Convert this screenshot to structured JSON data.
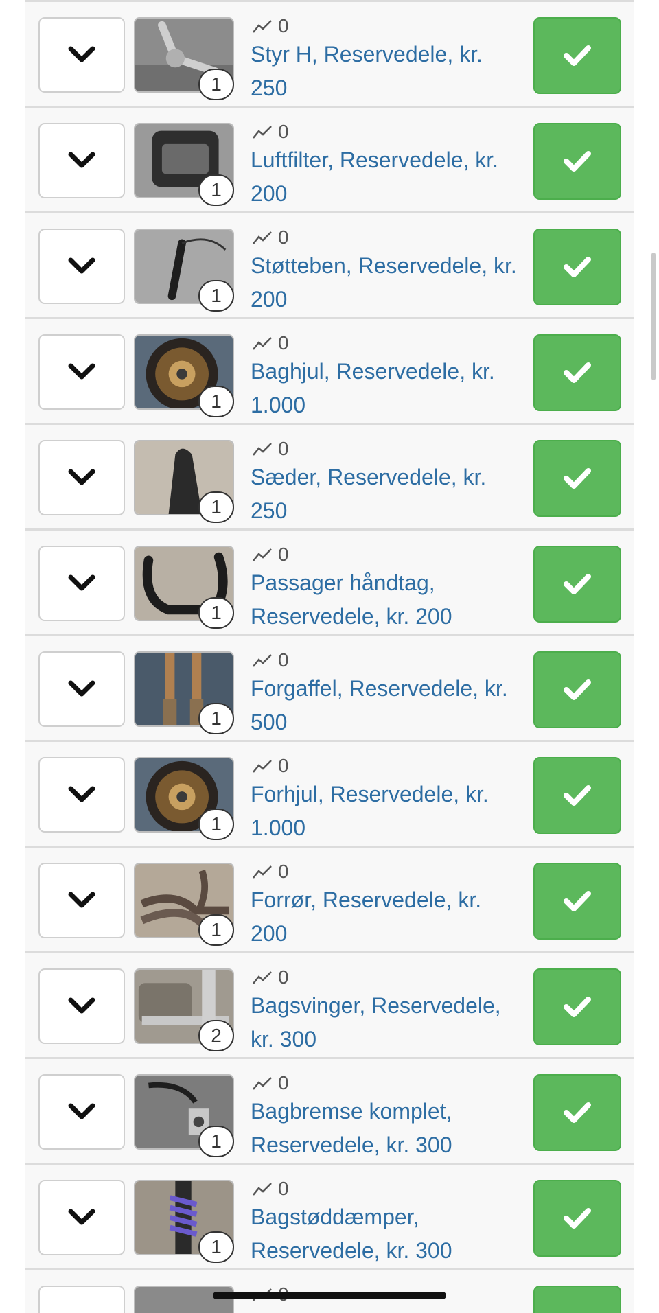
{
  "items": [
    {
      "title": "Styr H, Reservedele, kr. 250",
      "views": "0",
      "photo_count": "1",
      "thumb_icon": "handlebar-photo"
    },
    {
      "title": "Luftfilter, Reservedele, kr. 200",
      "views": "0",
      "photo_count": "1",
      "thumb_icon": "air-filter-photo"
    },
    {
      "title": "Støtteben, Reservedele, kr. 200",
      "views": "0",
      "photo_count": "1",
      "thumb_icon": "kickstand-photo"
    },
    {
      "title": "Baghjul, Reservedele, kr. 1.000",
      "views": "0",
      "photo_count": "1",
      "thumb_icon": "rear-wheel-photo"
    },
    {
      "title": "Sæder, Reservedele, kr. 250",
      "views": "0",
      "photo_count": "1",
      "thumb_icon": "seat-photo"
    },
    {
      "title": "Passager håndtag, Reservedele, kr. 200",
      "views": "0",
      "photo_count": "1",
      "thumb_icon": "passenger-handle-photo"
    },
    {
      "title": "Forgaffel, Reservedele, kr. 500",
      "views": "0",
      "photo_count": "1",
      "thumb_icon": "front-fork-photo"
    },
    {
      "title": "Forhjul, Reservedele, kr. 1.000",
      "views": "0",
      "photo_count": "1",
      "thumb_icon": "front-wheel-photo"
    },
    {
      "title": "Forrør, Reservedele, kr. 200",
      "views": "0",
      "photo_count": "1",
      "thumb_icon": "exhaust-pipes-photo"
    },
    {
      "title": "Bagsvinger, Reservedele, kr. 300",
      "views": "0",
      "photo_count": "2",
      "thumb_icon": "swingarm-photo"
    },
    {
      "title": "Bagbremse komplet, Reservedele, kr. 300",
      "views": "0",
      "photo_count": "1",
      "thumb_icon": "rear-brake-photo"
    },
    {
      "title": "Bagstøddæmper, Reservedele, kr. 300",
      "views": "0",
      "photo_count": "1",
      "thumb_icon": "rear-shock-photo"
    },
    {
      "title": "",
      "views": "0",
      "photo_count": "",
      "thumb_icon": "partial-item-photo"
    }
  ],
  "colors": {
    "accent_green": "#5cb85c",
    "link_blue": "#2d6da3",
    "row_background": "#f8f8f8"
  }
}
